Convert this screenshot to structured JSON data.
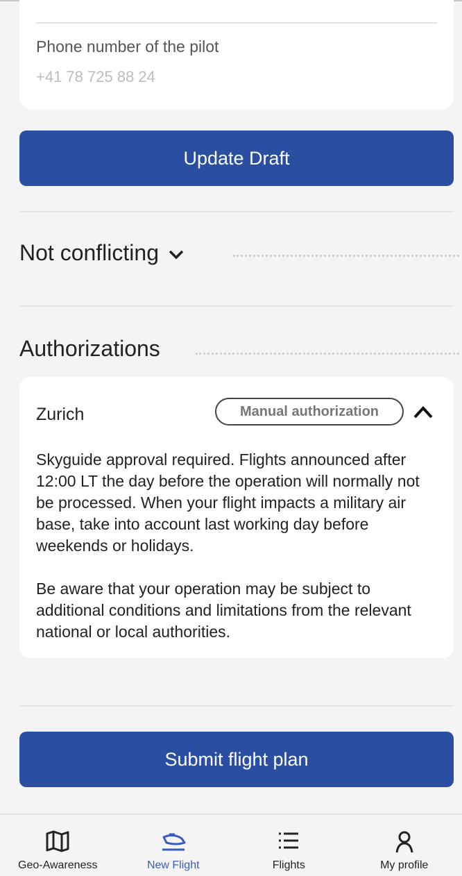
{
  "pilot": {
    "phone_label": "Phone number of the pilot",
    "phone_value": "+41 78 725 88 24"
  },
  "buttons": {
    "update_draft": "Update Draft",
    "submit": "Submit flight plan"
  },
  "conflicts": {
    "title": "Not conflicting"
  },
  "authorizations": {
    "title": "Authorizations",
    "items": [
      {
        "name": "Zurich",
        "badge": "Manual authorization",
        "paragraphs": [
          "Skyguide approval required. Flights announced after 12:00 LT the day before the operation will normally not be processed. When your flight impacts a military air base, take into account last working day before weekends or holidays.",
          "Be aware that your operation may be subject to additional conditions and limitations from the relevant national or local authorities."
        ]
      }
    ]
  },
  "nav": {
    "items": [
      {
        "label": "Geo-Awareness",
        "icon": "map-icon"
      },
      {
        "label": "New Flight",
        "icon": "drone-icon",
        "active": true
      },
      {
        "label": "Flights",
        "icon": "list-icon"
      },
      {
        "label": "My profile",
        "icon": "person-icon"
      }
    ]
  },
  "colors": {
    "accent": "#2a4fa2",
    "active_nav": "#3a5bbd"
  }
}
